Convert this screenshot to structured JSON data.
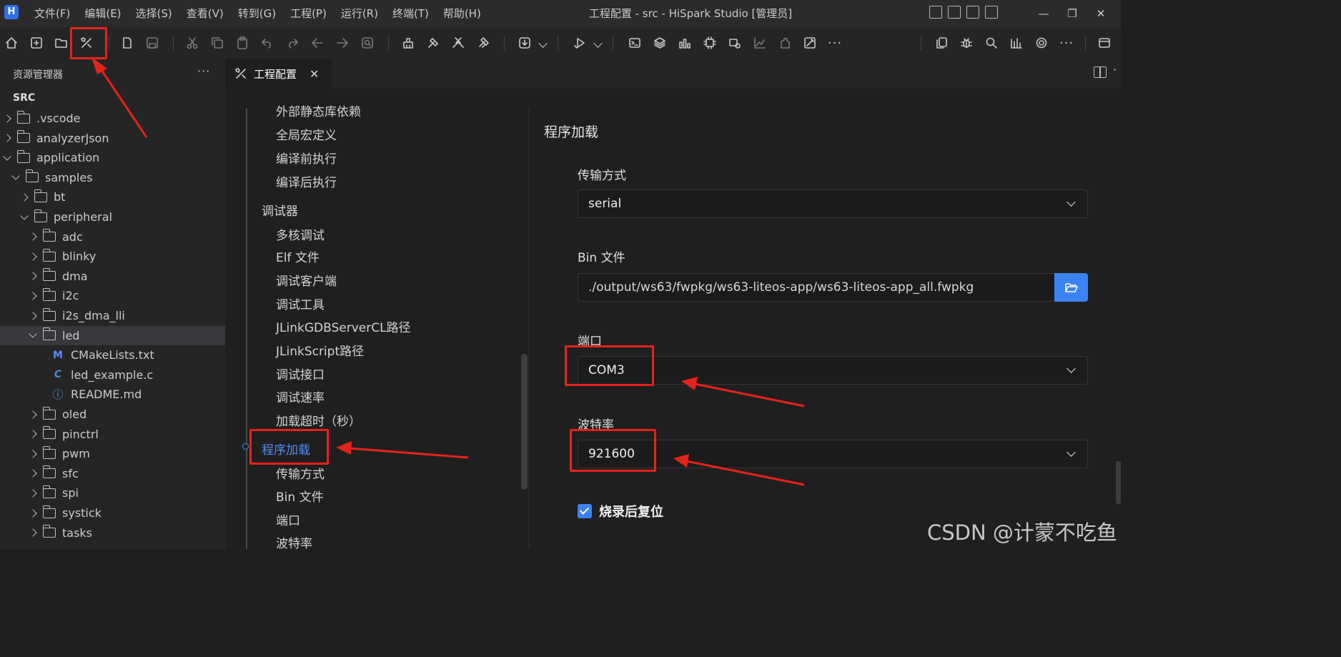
{
  "app": {
    "logo_text": "H",
    "window_title": "工程配置 - src - HiSpark Studio [管理员]",
    "menu": [
      "文件(F)",
      "编辑(E)",
      "选择(S)",
      "查看(V)",
      "转到(G)",
      "工程(P)",
      "运行(R)",
      "终端(T)",
      "帮助(H)"
    ]
  },
  "sidebar": {
    "title": "资源管理器",
    "more": "···",
    "root": "SRC",
    "items": [
      {
        "label": ".vscode",
        "kind": "folder",
        "state": "closed"
      },
      {
        "label": "analyzerJson",
        "kind": "folder",
        "state": "closed"
      },
      {
        "label": "application",
        "kind": "folder",
        "state": "open"
      },
      {
        "label": "samples",
        "kind": "folder",
        "state": "open"
      },
      {
        "label": "bt",
        "kind": "folder",
        "state": "closed"
      },
      {
        "label": "peripheral",
        "kind": "folder",
        "state": "open"
      },
      {
        "label": "adc",
        "kind": "folder",
        "state": "closed"
      },
      {
        "label": "blinky",
        "kind": "folder",
        "state": "closed"
      },
      {
        "label": "dma",
        "kind": "folder",
        "state": "closed"
      },
      {
        "label": "i2c",
        "kind": "folder",
        "state": "closed"
      },
      {
        "label": "i2s_dma_lli",
        "kind": "folder",
        "state": "closed"
      },
      {
        "label": "led",
        "kind": "folder",
        "state": "open",
        "selected": true
      },
      {
        "label": "CMakeLists.txt",
        "kind": "file",
        "icon": "M"
      },
      {
        "label": "led_example.c",
        "kind": "file",
        "icon": "C"
      },
      {
        "label": "README.md",
        "kind": "file",
        "icon": "ⓘ"
      },
      {
        "label": "oled",
        "kind": "folder",
        "state": "closed"
      },
      {
        "label": "pinctrl",
        "kind": "folder",
        "state": "closed"
      },
      {
        "label": "pwm",
        "kind": "folder",
        "state": "closed"
      },
      {
        "label": "sfc",
        "kind": "folder",
        "state": "closed"
      },
      {
        "label": "spi",
        "kind": "folder",
        "state": "closed"
      },
      {
        "label": "systick",
        "kind": "folder",
        "state": "closed"
      },
      {
        "label": "tasks",
        "kind": "folder",
        "state": "closed"
      }
    ]
  },
  "tab": {
    "label": "工程配置",
    "close": "✕",
    "more": "·"
  },
  "nav": {
    "items": [
      {
        "label": "外部静态库依赖",
        "level": 2
      },
      {
        "label": "全局宏定义",
        "level": 2
      },
      {
        "label": "编译前执行",
        "level": 2
      },
      {
        "label": "编译后执行",
        "level": 2
      },
      {
        "label": "调试器",
        "level": 1
      },
      {
        "label": "多核调试",
        "level": 2
      },
      {
        "label": "Elf 文件",
        "level": 2
      },
      {
        "label": "调试客户端",
        "level": 2
      },
      {
        "label": "调试工具",
        "level": 2
      },
      {
        "label": "JLinkGDBServerCL路径",
        "level": 2
      },
      {
        "label": "JLinkScript路径",
        "level": 2
      },
      {
        "label": "调试接口",
        "level": 2
      },
      {
        "label": "调试速率",
        "level": 2
      },
      {
        "label": "加载超时（秒）",
        "level": 2
      },
      {
        "label": "程序加载",
        "level": 1,
        "active": true
      },
      {
        "label": "传输方式",
        "level": 2
      },
      {
        "label": "Bin 文件",
        "level": 2
      },
      {
        "label": "端口",
        "level": 2
      },
      {
        "label": "波特率",
        "level": 2
      }
    ]
  },
  "form": {
    "section_title": "程序加载",
    "transfer_label": "传输方式",
    "transfer_value": "serial",
    "bin_label": "Bin 文件",
    "bin_value": "./output/ws63/fwpkg/ws63-liteos-app/ws63-liteos-app_all.fwpkg",
    "port_label": "端口",
    "port_value": "COM3",
    "baud_label": "波特率",
    "baud_value": "921600",
    "reset_label": "烧录后复位",
    "reset_checked": true
  },
  "watermark": "CSDN @计蒙不吃鱼",
  "colors": {
    "accent": "#3b82f6",
    "annotation": "#e5231b"
  }
}
